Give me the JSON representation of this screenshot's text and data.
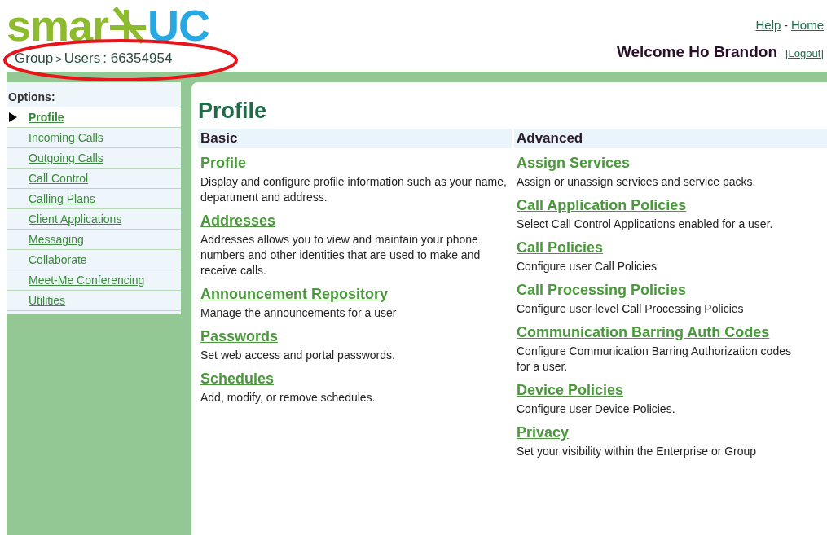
{
  "logo": {
    "left": "smar",
    "right": "UC"
  },
  "breadcrumb": {
    "links": [
      "Group",
      "Users"
    ],
    "separator": ">",
    "current": ": 66354954"
  },
  "header_links": {
    "items": [
      "Help",
      "Home"
    ],
    "separator": "-"
  },
  "welcome": "Welcome Ho Brandon",
  "logout": "[Logout]",
  "sidebar": {
    "title": "Options:",
    "items": [
      {
        "label": "Profile",
        "selected": true
      },
      {
        "label": "Incoming Calls",
        "selected": false
      },
      {
        "label": "Outgoing Calls",
        "selected": false
      },
      {
        "label": "Call Control",
        "selected": false
      },
      {
        "label": "Calling Plans",
        "selected": false
      },
      {
        "label": "Client Applications",
        "selected": false
      },
      {
        "label": "Messaging",
        "selected": false
      },
      {
        "label": "Collaborate",
        "selected": false
      },
      {
        "label": "Meet-Me Conferencing",
        "selected": false
      },
      {
        "label": "Utilities",
        "selected": false
      }
    ]
  },
  "page_title": "Profile",
  "sections": [
    {
      "heading": "Basic",
      "entries": [
        {
          "link": "Profile",
          "description": "Display and configure profile information such as your name, department and address."
        },
        {
          "link": "Addresses",
          "description": "Addresses allows you to view and maintain your phone numbers and other identities that are used to make and receive calls."
        },
        {
          "link": "Announcement Repository",
          "description": "Manage the announcements for a user"
        },
        {
          "link": "Passwords",
          "description": "Set web access and portal passwords."
        },
        {
          "link": "Schedules",
          "description": "Add, modify, or remove schedules."
        }
      ]
    },
    {
      "heading": "Advanced",
      "entries": [
        {
          "link": "Assign Services",
          "description": "Assign or unassign services and service packs."
        },
        {
          "link": "Call Application Policies",
          "description": "Select Call Control Applications enabled for a user."
        },
        {
          "link": "Call Policies",
          "description": "Configure user Call Policies"
        },
        {
          "link": "Call Processing Policies",
          "description": "Configure user-level Call Processing Policies"
        },
        {
          "link": "Communication Barring Auth Codes",
          "description": "Configure Communication Barring Authorization codes for a user."
        },
        {
          "link": "Device Policies",
          "description": "Configure user Device Policies."
        },
        {
          "link": "Privacy",
          "description": "Set your visibility within the Enterprise or Group"
        }
      ]
    }
  ]
}
